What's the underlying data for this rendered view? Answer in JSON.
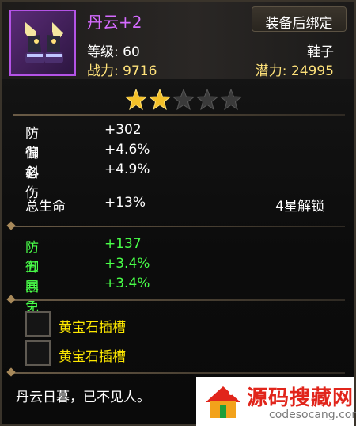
{
  "item": {
    "name": "丹云+2",
    "bind_status": "装备后绑定",
    "level": "等级: 60",
    "type": "鞋子",
    "power": "战力: 9716",
    "potential": "潜力: 24995",
    "stars": {
      "filled": 2,
      "total": 5
    },
    "icon": "winged-boots-icon"
  },
  "base_stats": [
    {
      "label": "防御",
      "value": "+302"
    },
    {
      "label": "偏斜",
      "value": "+4.6%"
    },
    {
      "label": "必伤",
      "value": "+4.9%"
    }
  ],
  "bonus_stat": {
    "label": "总生命",
    "value": "+13%",
    "unlock": "4星解锁"
  },
  "extra_stats": [
    {
      "label": "防御",
      "value": "+137"
    },
    {
      "label": "五回",
      "value": "+3.4%"
    },
    {
      "label": "暴免",
      "value": "+3.4%"
    }
  ],
  "sockets": [
    {
      "label": "黄宝石插槽"
    },
    {
      "label": "黄宝石插槽"
    }
  ],
  "flavor_text": "丹云日暮，已不见人。",
  "watermark": {
    "cn": "源码搜藏网",
    "en": "codesocang.com"
  },
  "colors": {
    "name": "#d56bff",
    "highlight": "#ffe27a",
    "extra_stat": "#49ff49",
    "socket": "#ffe900"
  }
}
